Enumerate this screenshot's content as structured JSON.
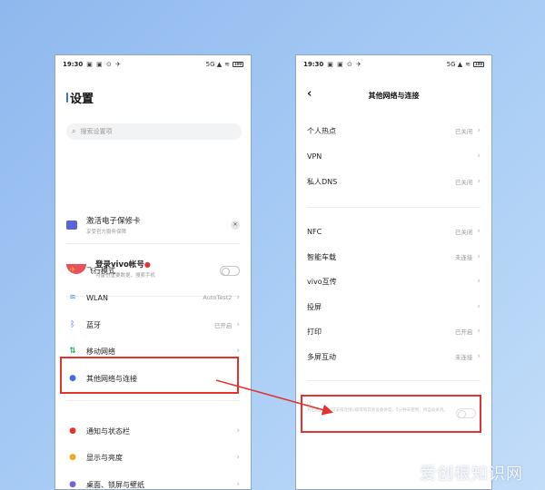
{
  "left_phone": {
    "status": {
      "time": "19:30",
      "icons": "▣ ▣ ⊙ ✈",
      "network": "5G ▲",
      "battery": "100"
    },
    "title": "设置",
    "search_placeholder": "搜索设置项",
    "card1": {
      "title": "激活电子保修卡",
      "subtitle": "享受官方服务保障",
      "close": "✕"
    },
    "account": {
      "title": "登录vivo帐号",
      "subtitle": "可备份重要数据，搜索手机"
    },
    "items": [
      {
        "label": "飞行模式",
        "value": "",
        "icon": "airplane-icon"
      },
      {
        "label": "WLAN",
        "value": "AutoTest2",
        "icon": "wifi-icon"
      },
      {
        "label": "蓝牙",
        "value": "已开启",
        "icon": "bluetooth-icon"
      },
      {
        "label": "移动网络",
        "value": "",
        "icon": "mobile-data-icon"
      },
      {
        "label": "其他网络与连接",
        "value": "",
        "icon": "link-icon"
      },
      {
        "label": "通知与状态栏",
        "value": "",
        "icon": "notification-icon"
      },
      {
        "label": "显示与亮度",
        "value": "",
        "icon": "brightness-icon"
      },
      {
        "label": "桌面、锁屏与壁纸",
        "value": "",
        "icon": "wallpaper-icon"
      }
    ]
  },
  "right_phone": {
    "status": {
      "time": "19:30",
      "icons": "▣ ▣ ⊙ ✈",
      "network": "5G ▲",
      "battery": "100"
    },
    "title": "其他网络与连接",
    "back": "‹",
    "items": [
      {
        "label": "个人热点",
        "value": "已关闭"
      },
      {
        "label": "VPN",
        "value": ""
      },
      {
        "label": "私人DNS",
        "value": "已关闭"
      },
      {
        "label": "NFC",
        "value": "已关闭"
      },
      {
        "label": "智能车载",
        "value": "未连接"
      },
      {
        "label": "vivo互传",
        "value": ""
      },
      {
        "label": "投屏",
        "value": ""
      },
      {
        "label": "打印",
        "value": "已开启"
      },
      {
        "label": "多屏互动",
        "value": "未连接"
      }
    ],
    "bottom_setting": {
      "description": "开启后，手机可安排连接U盘或和其他设备供电，5分钟未使用，将自动关闭。"
    }
  },
  "colors": {
    "highlight": "#e2332f",
    "accent": "#3b6fe8",
    "background": "#a9cdf5"
  },
  "watermark": "爱创根知识网"
}
